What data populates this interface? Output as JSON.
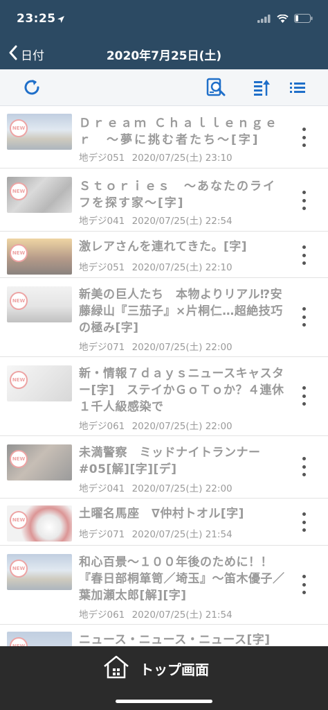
{
  "status": {
    "time": "23:25",
    "location_icon": "location-arrow-icon",
    "signal_icon": "signal-icon",
    "wifi_icon": "wifi-icon",
    "battery_icon": "battery-icon"
  },
  "nav": {
    "back_label": "日付",
    "title": "2020年7月25日(土)"
  },
  "toolbar": {
    "refresh_icon": "refresh-icon",
    "search_icon": "search-document-icon",
    "sort_icon": "sort-icon",
    "list_icon": "list-icon"
  },
  "colors": {
    "header_bg": "#2c4a63",
    "accent": "#1f6fc9",
    "tabbar_bg": "#2b2b2b",
    "text_muted": "#9a9a9a"
  },
  "programs": [
    {
      "title": "Ｄｒｅａｍ Ｃｈａｌｌｅｎｇｅｒ　〜夢に挑む者たち〜[字]",
      "channel": "地デジ051",
      "datetime": "2020/07/25(土) 23:10",
      "badge": "NEW"
    },
    {
      "title": "Ｓｔｏｒｉｅｓ　〜あなたのライフを探す家〜[字]",
      "channel": "地デジ041",
      "datetime": "2020/07/25(土) 22:54",
      "badge": "NEW"
    },
    {
      "title": "激レアさんを連れてきた。[字]",
      "channel": "地デジ051",
      "datetime": "2020/07/25(土) 22:10",
      "badge": "NEW"
    },
    {
      "title": "新美の巨人たち　本物よりリアル⁉安藤緑山『三茄子』×片桐仁…超絶技巧の極み[字]",
      "channel": "地デジ071",
      "datetime": "2020/07/25(土) 22:00",
      "badge": "NEW"
    },
    {
      "title": "新・情報７ｄａｙｓニュースキャスター[字]　ステイかＧｏＴｏか？４連休１千人級感染で",
      "channel": "地デジ061",
      "datetime": "2020/07/25(土) 22:00",
      "badge": "NEW"
    },
    {
      "title": "未満警察　ミッドナイトランナー　#05[解][字][デ]",
      "channel": "地デジ041",
      "datetime": "2020/07/25(土) 22:00",
      "badge": "NEW"
    },
    {
      "title": "土曜名馬座　∇仲村トオル[字]",
      "channel": "地デジ071",
      "datetime": "2020/07/25(土) 21:54",
      "badge": "NEW"
    },
    {
      "title": "和心百景〜１００年後のために！！『春日部桐箪笥／埼玉』〜笛木優子／葉加瀬太郎[解][字]",
      "channel": "地デジ061",
      "datetime": "2020/07/25(土) 21:54",
      "badge": "NEW"
    },
    {
      "title": "ニュース・ニュース・ニュース[字]",
      "channel": "",
      "datetime": "",
      "badge": "NEW"
    }
  ],
  "tabbar": {
    "home_icon": "home-icon",
    "home_label": "トップ画面"
  }
}
